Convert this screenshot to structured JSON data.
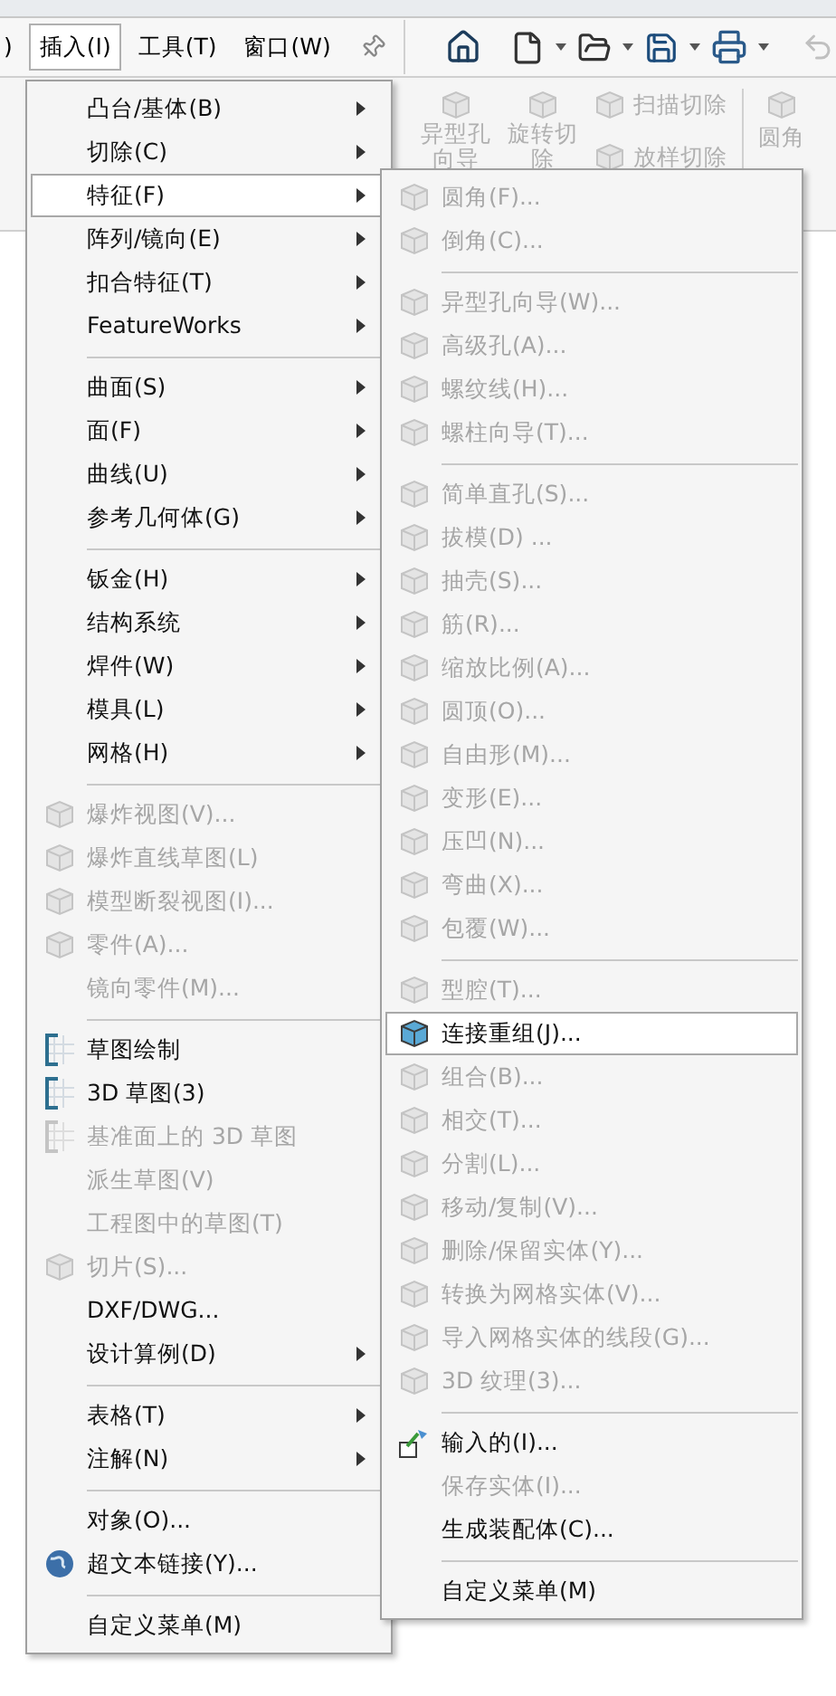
{
  "menu_bar": [
    {
      "label": ")",
      "selected": false
    },
    {
      "label": "插入(I)",
      "selected": true
    },
    {
      "label": "工具(T)",
      "selected": false
    },
    {
      "label": "窗口(W)",
      "selected": false
    }
  ],
  "ribbon": [
    {
      "label": "异型孔向导"
    },
    {
      "label": "旋转切除"
    },
    {
      "label": "扫描切除"
    },
    {
      "label": "放样切除"
    },
    {
      "label": "圆角"
    }
  ],
  "insert_menu": [
    {
      "kind": "plain",
      "label": "凸台/基体(B)",
      "disabled": false,
      "has_submenu": true,
      "selected": false
    },
    {
      "kind": "plain",
      "label": "切除(C)",
      "disabled": false,
      "has_submenu": true,
      "selected": false
    },
    {
      "kind": "plain",
      "label": "特征(F)",
      "disabled": false,
      "has_submenu": true,
      "selected": true
    },
    {
      "kind": "plain",
      "label": "阵列/镜向(E)",
      "disabled": false,
      "has_submenu": true,
      "selected": false
    },
    {
      "kind": "plain",
      "label": "扣合特征(T)",
      "disabled": false,
      "has_submenu": true,
      "selected": false
    },
    {
      "kind": "plain",
      "label": "FeatureWorks",
      "disabled": false,
      "has_submenu": true,
      "selected": false
    },
    {
      "kind": "separator"
    },
    {
      "kind": "plain",
      "label": "曲面(S)",
      "disabled": false,
      "has_submenu": true,
      "selected": false
    },
    {
      "kind": "plain",
      "label": "面(F)",
      "disabled": false,
      "has_submenu": true,
      "selected": false
    },
    {
      "kind": "plain",
      "label": "曲线(U)",
      "disabled": false,
      "has_submenu": true,
      "selected": false
    },
    {
      "kind": "plain",
      "label": "参考几何体(G)",
      "disabled": false,
      "has_submenu": true,
      "selected": false
    },
    {
      "kind": "separator"
    },
    {
      "kind": "plain",
      "label": "钣金(H)",
      "disabled": false,
      "has_submenu": true,
      "selected": false
    },
    {
      "kind": "plain",
      "label": "结构系统",
      "disabled": false,
      "has_submenu": true,
      "selected": false
    },
    {
      "kind": "plain",
      "label": "焊件(W)",
      "disabled": false,
      "has_submenu": true,
      "selected": false
    },
    {
      "kind": "plain",
      "label": "模具(L)",
      "disabled": false,
      "has_submenu": true,
      "selected": false
    },
    {
      "kind": "plain",
      "label": "网格(H)",
      "disabled": false,
      "has_submenu": true,
      "selected": false
    },
    {
      "kind": "separator"
    },
    {
      "kind": "cube",
      "label": "爆炸视图(V)...",
      "disabled": true,
      "has_submenu": false,
      "selected": false
    },
    {
      "kind": "cube",
      "label": "爆炸直线草图(L)",
      "disabled": true,
      "has_submenu": false,
      "selected": false
    },
    {
      "kind": "cube",
      "label": "模型断裂视图(I)...",
      "disabled": true,
      "has_submenu": false,
      "selected": false
    },
    {
      "kind": "cube",
      "label": "零件(A)...",
      "disabled": true,
      "has_submenu": false,
      "selected": false
    },
    {
      "kind": "plain",
      "label": "镜向零件(M)...",
      "disabled": true,
      "has_submenu": false,
      "selected": false
    },
    {
      "kind": "separator"
    },
    {
      "kind": "sketch",
      "label": "草图绘制",
      "disabled": false,
      "has_submenu": false,
      "selected": false
    },
    {
      "kind": "sketch",
      "label": "3D 草图(3)",
      "disabled": false,
      "has_submenu": false,
      "selected": false
    },
    {
      "kind": "sketch",
      "label": "基准面上的 3D 草图",
      "disabled": true,
      "has_submenu": false,
      "selected": false
    },
    {
      "kind": "plain",
      "label": "派生草图(V)",
      "disabled": true,
      "has_submenu": false,
      "selected": false
    },
    {
      "kind": "plain",
      "label": "工程图中的草图(T)",
      "disabled": true,
      "has_submenu": false,
      "selected": false
    },
    {
      "kind": "cube",
      "label": "切片(S)...",
      "disabled": true,
      "has_submenu": false,
      "selected": false
    },
    {
      "kind": "plain",
      "label": "DXF/DWG...",
      "disabled": false,
      "has_submenu": false,
      "selected": false
    },
    {
      "kind": "plain",
      "label": "设计算例(D)",
      "disabled": false,
      "has_submenu": true,
      "selected": false
    },
    {
      "kind": "separator"
    },
    {
      "kind": "plain",
      "label": "表格(T)",
      "disabled": false,
      "has_submenu": true,
      "selected": false
    },
    {
      "kind": "plain",
      "label": "注解(N)",
      "disabled": false,
      "has_submenu": true,
      "selected": false
    },
    {
      "kind": "separator"
    },
    {
      "kind": "plain",
      "label": "对象(O)...",
      "disabled": false,
      "has_submenu": false,
      "selected": false
    },
    {
      "kind": "globe",
      "label": "超文本链接(Y)...",
      "disabled": false,
      "has_submenu": false,
      "selected": false
    },
    {
      "kind": "separator"
    },
    {
      "kind": "plain",
      "label": "自定义菜单(M)",
      "disabled": false,
      "has_submenu": false,
      "selected": false
    }
  ],
  "feature_submenu": [
    {
      "kind": "cube",
      "label": "圆角(F)...",
      "disabled": true,
      "selected": false
    },
    {
      "kind": "cube",
      "label": "倒角(C)...",
      "disabled": true,
      "selected": false
    },
    {
      "kind": "separator"
    },
    {
      "kind": "cube",
      "label": "异型孔向导(W)...",
      "disabled": true,
      "selected": false
    },
    {
      "kind": "cube",
      "label": "高级孔(A)...",
      "disabled": true,
      "selected": false
    },
    {
      "kind": "cube",
      "label": "螺纹线(H)...",
      "disabled": true,
      "selected": false
    },
    {
      "kind": "cube",
      "label": "螺柱向导(T)...",
      "disabled": true,
      "selected": false
    },
    {
      "kind": "separator"
    },
    {
      "kind": "cube",
      "label": "简单直孔(S)...",
      "disabled": true,
      "selected": false
    },
    {
      "kind": "cube",
      "label": "拔模(D) ...",
      "disabled": true,
      "selected": false
    },
    {
      "kind": "cube",
      "label": "抽壳(S)...",
      "disabled": true,
      "selected": false
    },
    {
      "kind": "cube",
      "label": "筋(R)...",
      "disabled": true,
      "selected": false
    },
    {
      "kind": "cube",
      "label": "缩放比例(A)...",
      "disabled": true,
      "selected": false
    },
    {
      "kind": "cube",
      "label": "圆顶(O)...",
      "disabled": true,
      "selected": false
    },
    {
      "kind": "cube",
      "label": "自由形(M)...",
      "disabled": true,
      "selected": false
    },
    {
      "kind": "cube",
      "label": "变形(E)...",
      "disabled": true,
      "selected": false
    },
    {
      "kind": "cube",
      "label": "压凹(N)...",
      "disabled": true,
      "selected": false
    },
    {
      "kind": "cube",
      "label": "弯曲(X)...",
      "disabled": true,
      "selected": false
    },
    {
      "kind": "cube",
      "label": "包覆(W)...",
      "disabled": true,
      "selected": false
    },
    {
      "kind": "separator"
    },
    {
      "kind": "cube",
      "label": "型腔(T)...",
      "disabled": true,
      "selected": false
    },
    {
      "kind": "cube",
      "label": "连接重组(J)...",
      "disabled": false,
      "selected": true
    },
    {
      "kind": "cube",
      "label": "组合(B)...",
      "disabled": true,
      "selected": false
    },
    {
      "kind": "cube",
      "label": "相交(T)...",
      "disabled": true,
      "selected": false
    },
    {
      "kind": "cube",
      "label": "分割(L)...",
      "disabled": true,
      "selected": false
    },
    {
      "kind": "cube",
      "label": "移动/复制(V)...",
      "disabled": true,
      "selected": false
    },
    {
      "kind": "cube",
      "label": "删除/保留实体(Y)...",
      "disabled": true,
      "selected": false
    },
    {
      "kind": "cube",
      "label": "转换为网格实体(V)...",
      "disabled": true,
      "selected": false
    },
    {
      "kind": "cube",
      "label": "导入网格实体的线段(G)...",
      "disabled": true,
      "selected": false
    },
    {
      "kind": "cube",
      "label": "3D 纹理(3)...",
      "disabled": true,
      "selected": false
    },
    {
      "kind": "separator"
    },
    {
      "kind": "import",
      "label": "输入的(I)...",
      "disabled": false,
      "selected": false
    },
    {
      "kind": "plain",
      "label": "保存实体(I)...",
      "disabled": true,
      "selected": false
    },
    {
      "kind": "plain",
      "label": "生成装配体(C)...",
      "disabled": false,
      "selected": false
    },
    {
      "kind": "separator"
    },
    {
      "kind": "plain",
      "label": "自定义菜单(M)",
      "disabled": false,
      "selected": false
    }
  ]
}
